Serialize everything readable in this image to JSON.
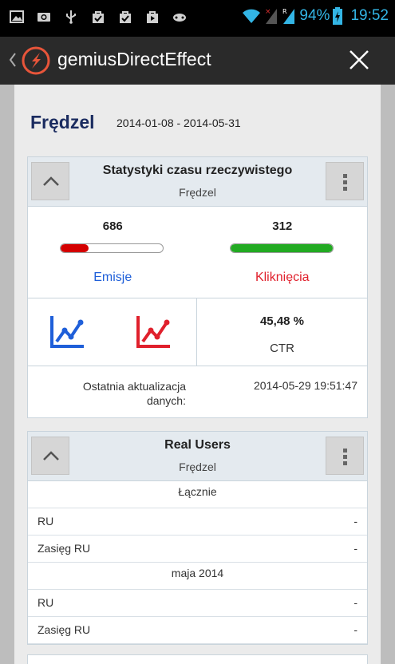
{
  "status_bar": {
    "battery_percent": "94%",
    "time": "19:52",
    "left_icons": [
      "image-icon",
      "camera-icon",
      "usb-icon",
      "bag-check-icon",
      "bag-check-icon",
      "play-store-icon",
      "gamepad-icon"
    ],
    "right_icons": [
      "wifi-icon",
      "signal-no-service-icon",
      "signal-roaming-icon",
      "battery-charging-icon"
    ],
    "accent_color": "#33b5e5"
  },
  "action_bar": {
    "title": "gemiusDirectEffect",
    "logo_color": "#e8553a"
  },
  "page": {
    "title": "Frędzel",
    "dates": "2014-01-08 - 2014-05-31"
  },
  "realtime_card": {
    "title": "Statystyki czasu rzeczywistego",
    "subtitle": "Frędzel",
    "emissions": {
      "value": "686",
      "label": "Emisje",
      "bar_fraction": 0.27,
      "color": "#1f5fd9",
      "bar_color": "#d40000"
    },
    "clicks": {
      "value": "312",
      "label": "Kliknięcia",
      "bar_fraction": 1.0,
      "color": "#e0202c",
      "bar_color": "#22aa22"
    },
    "ctr": {
      "value": "45,48 %",
      "label": "CTR"
    },
    "last_update": {
      "label": "Ostatnia aktualizacja danych:",
      "value": "2014-05-29 19:51:47"
    }
  },
  "real_users_card": {
    "title": "Real Users",
    "subtitle": "Frędzel",
    "sections": [
      {
        "title": "Łącznie",
        "rows": [
          {
            "key": "RU",
            "value": "-"
          },
          {
            "key": "Zasięg RU",
            "value": "-"
          }
        ]
      },
      {
        "title": "maja 2014",
        "rows": [
          {
            "key": "RU",
            "value": "-"
          },
          {
            "key": "Zasięg RU",
            "value": "-"
          }
        ]
      }
    ]
  }
}
